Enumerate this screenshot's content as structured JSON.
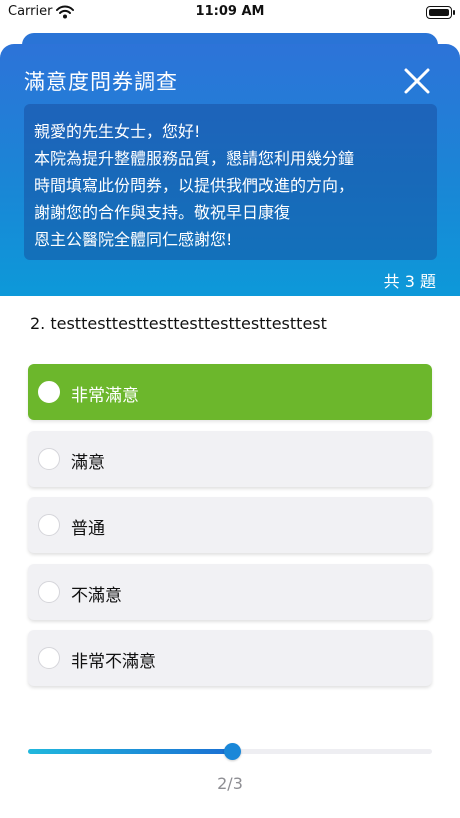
{
  "status_bar": {
    "carrier": "Carrier",
    "time": "11:09 AM",
    "icons": [
      "wifi-icon",
      "battery-icon"
    ]
  },
  "header": {
    "title": "滿意度問券調查",
    "close_icon": "close-icon",
    "intro": "親愛的先生女士，您好!\n本院為提升整體服務品質，懇請您利用幾分鐘\n時間填寫此份問券，以提供我們改進的方向，\n謝謝您的合作與支持。敬祝早日康復\n恩主公醫院全體同仁感謝您!",
    "question_count": "共 3 題"
  },
  "question": {
    "text": "2. testtesttesttesttesttesttesttesttest",
    "selected_index": 0,
    "options": [
      {
        "label": "非常滿意"
      },
      {
        "label": "滿意"
      },
      {
        "label": "普通"
      },
      {
        "label": "不滿意"
      },
      {
        "label": "非常不滿意"
      }
    ]
  },
  "progress": {
    "current": 2,
    "total": 3,
    "fraction": 0.505,
    "label": "2/3"
  },
  "colors": {
    "header_top": "#2d73d8",
    "header_bottom": "#0d99d9",
    "selected_option": "#6cb72c",
    "option_background": "#f1f1f4",
    "progress_start": "#21b8dd",
    "progress_end": "#1a6fd3"
  }
}
